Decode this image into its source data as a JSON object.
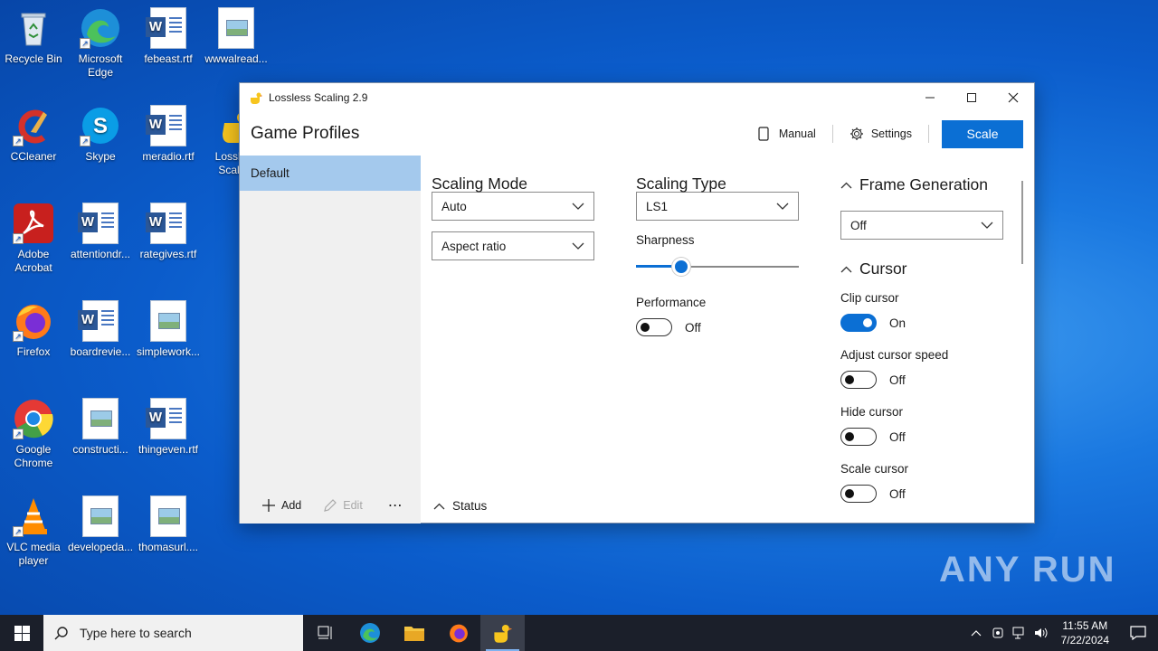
{
  "desktop": {
    "icons": [
      {
        "label": "Recycle Bin",
        "icon": "recycle-bin-icon"
      },
      {
        "label": "Microsoft Edge",
        "icon": "edge-icon"
      },
      {
        "label": "febeast.rtf",
        "icon": "word-doc-icon"
      },
      {
        "label": "wwwalread...",
        "icon": "image-file-icon"
      },
      {
        "label": "CCleaner",
        "icon": "ccleaner-icon"
      },
      {
        "label": "Skype",
        "icon": "skype-icon"
      },
      {
        "label": "meradio.rtf",
        "icon": "word-doc-icon"
      },
      {
        "label": "Lossless Scaling",
        "icon": "lossless-scaling-icon"
      },
      {
        "label": "Adobe Acrobat",
        "icon": "acrobat-icon"
      },
      {
        "label": "attentiondr...",
        "icon": "word-doc-icon"
      },
      {
        "label": "rategives.rtf",
        "icon": "word-doc-icon"
      },
      {
        "label": "Firefox",
        "icon": "firefox-icon"
      },
      {
        "label": "boardrevie...",
        "icon": "word-doc-icon"
      },
      {
        "label": "simplework...",
        "icon": "image-file-icon"
      },
      {
        "label": "Google Chrome",
        "icon": "chrome-icon"
      },
      {
        "label": "constructi...",
        "icon": "image-file-icon"
      },
      {
        "label": "thingeven.rtf",
        "icon": "word-doc-icon"
      },
      {
        "label": "VLC media player",
        "icon": "vlc-icon"
      },
      {
        "label": "developeda...",
        "icon": "image-file-icon"
      },
      {
        "label": "thomasurl....",
        "icon": "image-file-icon"
      }
    ]
  },
  "window": {
    "title": "Lossless Scaling 2.9",
    "header": {
      "title": "Game Profiles",
      "manual_label": "Manual",
      "settings_label": "Settings",
      "scale_label": "Scale"
    },
    "sidebar": {
      "profiles": [
        "Default"
      ],
      "add_label": "Add",
      "edit_label": "Edit",
      "more_label": "⋯"
    },
    "scaling_mode": {
      "title": "Scaling Mode",
      "mode_value": "Auto",
      "aspect_value": "Aspect ratio"
    },
    "scaling_type": {
      "title": "Scaling Type",
      "type_value": "LS1",
      "sharpness_label": "Sharpness",
      "sharpness_level": 0.28,
      "performance_label": "Performance",
      "performance_state": "Off"
    },
    "frame_generation": {
      "title": "Frame Generation",
      "value": "Off"
    },
    "cursor": {
      "title": "Cursor",
      "clip_label": "Clip cursor",
      "clip_state": "On",
      "adjust_label": "Adjust cursor speed",
      "adjust_state": "Off",
      "hide_label": "Hide cursor",
      "hide_state": "Off",
      "scale_label": "Scale cursor",
      "scale_state": "Off"
    },
    "status_label": "Status"
  },
  "taskbar": {
    "search_placeholder": "Type here to search",
    "time": "11:55 AM",
    "date": "7/22/2024"
  },
  "watermark": "ANY RUN",
  "colors": {
    "accent": "#0b6fd4",
    "selected_profile": "#a4c9ed",
    "taskbar": "#1b1f2a"
  }
}
